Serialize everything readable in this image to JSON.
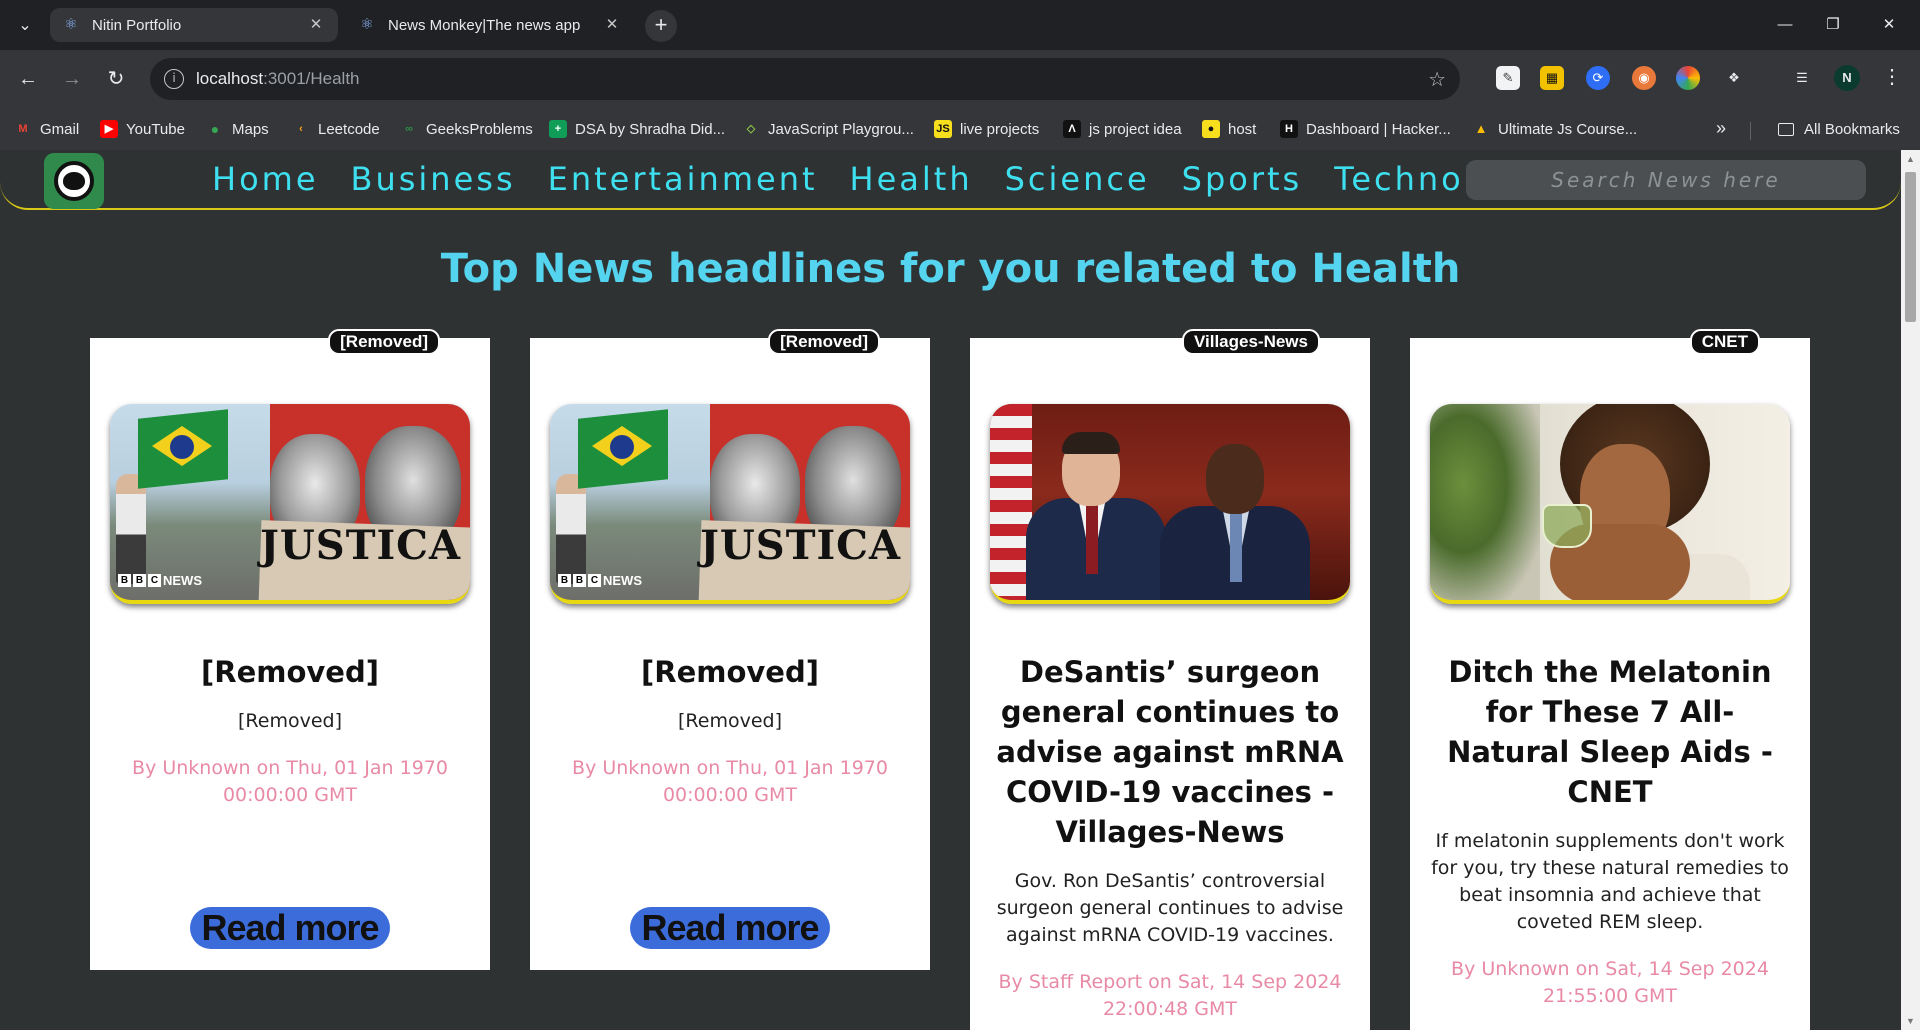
{
  "browser": {
    "tabs": [
      {
        "title": "Nitin Portfolio"
      },
      {
        "title": "News Monkey|The news app"
      }
    ],
    "url": {
      "host": "localhost",
      "path": ":3001/Health"
    },
    "profile_initial": "N",
    "bookmarks": [
      {
        "label": "Gmail",
        "icon": "gmail-icon"
      },
      {
        "label": "YouTube",
        "icon": "youtube-icon"
      },
      {
        "label": "Maps",
        "icon": "maps-icon"
      },
      {
        "label": "Leetcode",
        "icon": "leetcode-icon"
      },
      {
        "label": "GeeksProblems",
        "icon": "gfg-icon"
      },
      {
        "label": "DSA by Shradha Did...",
        "icon": "sheets-icon"
      },
      {
        "label": "JavaScript Playgrou...",
        "icon": "code-icon"
      },
      {
        "label": "live projects",
        "icon": "js-icon"
      },
      {
        "label": "js project idea",
        "icon": "nextjs-icon"
      },
      {
        "label": "host",
        "icon": "host-icon"
      },
      {
        "label": "Dashboard | Hacker...",
        "icon": "hackerrank-icon"
      },
      {
        "label": "Ultimate Js Course...",
        "icon": "drive-icon"
      }
    ],
    "all_bookmarks_label": "All Bookmarks"
  },
  "navbar": {
    "links": [
      "Home",
      "Business",
      "Entertainment",
      "Health",
      "Science",
      "Sports",
      "Technology"
    ],
    "search_placeholder": "Search News here"
  },
  "page": {
    "headline": "Top News headlines for you related to Health",
    "read_more_label": "Read more"
  },
  "articles": [
    {
      "source": "[Removed]",
      "title": "[Removed]",
      "description": "[Removed]",
      "byline": "By Unknown on Thu, 01 Jan 1970 00:00:00 GMT",
      "image": "bbc-news-justica-protest",
      "image_caption_logo": "NEWS"
    },
    {
      "source": "[Removed]",
      "title": "[Removed]",
      "description": "[Removed]",
      "byline": "By Unknown on Thu, 01 Jan 1970 00:00:00 GMT",
      "image": "bbc-news-justica-protest",
      "image_caption_logo": "NEWS"
    },
    {
      "source": "Villages-News",
      "title": "DeSantis’ surgeon general continues to advise against mRNA COVID-19 vaccines - Villages-News",
      "description": "Gov. Ron DeSantis’ controversial surgeon general continues to advise against mRNA COVID-19 vaccines.",
      "byline": "By Staff Report on Sat, 14 Sep 2024 22:00:48 GMT",
      "image": "desantis-surgeon-general"
    },
    {
      "source": "CNET",
      "title": "Ditch the Melatonin for These 7 All-Natural Sleep Aids - CNET",
      "description": "If melatonin supplements don't work for you, try these natural remedies to beat insomnia and achieve that coveted REM sleep.",
      "byline": "By Unknown on Sat, 14 Sep 2024 21:55:00 GMT",
      "image": "woman-drinking-tea"
    }
  ],
  "colors": {
    "page_bg": "#2f3233",
    "nav_link": "#3ee0f0",
    "headline": "#54d4ee",
    "byline": "#e88aa6",
    "read_more_bg": "#3c6cd9",
    "nav_border": "#d9c916"
  }
}
